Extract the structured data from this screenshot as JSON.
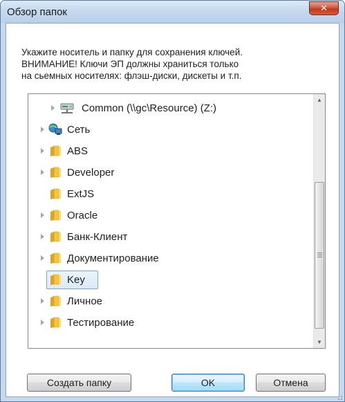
{
  "window": {
    "title": "Обзор папок",
    "close_glyph": "✕"
  },
  "instructions": {
    "line1": "Укажите носитель и папку для сохранения ключей.",
    "line2": "ВНИМАНИЕ! Ключи ЭП должны храниться только",
    "line3": "на сьемных носителях: флэш-диски, дискеты и т.п."
  },
  "tree": {
    "items": [
      {
        "label": "Common (\\\\gc\\Resource) (Z:)",
        "icon": "network-drive-icon",
        "expandable": true
      },
      {
        "label": "Сеть",
        "icon": "network-icon",
        "expandable": true
      },
      {
        "label": "ABS",
        "icon": "folder-icon",
        "expandable": true
      },
      {
        "label": "Developer",
        "icon": "folder-icon",
        "expandable": true
      },
      {
        "label": "ExtJS",
        "icon": "folder-icon",
        "expandable": false
      },
      {
        "label": "Oracle",
        "icon": "folder-icon",
        "expandable": true
      },
      {
        "label": "Банк-Клиент",
        "icon": "folder-icon",
        "expandable": true
      },
      {
        "label": "Документирование",
        "icon": "folder-icon",
        "expandable": true
      },
      {
        "label": "Key",
        "icon": "folder-icon",
        "expandable": false,
        "selected": true
      },
      {
        "label": "Личное",
        "icon": "folder-icon",
        "expandable": true
      },
      {
        "label": "Тестирование",
        "icon": "folder-icon",
        "expandable": true
      }
    ]
  },
  "buttons": {
    "new_folder": "Создать папку",
    "ok": "OK",
    "cancel": "Отмена"
  },
  "colors": {
    "selection_border": "#7da2ce",
    "folder_yellow": "#f5c542",
    "close_red": "#c23a1e"
  }
}
